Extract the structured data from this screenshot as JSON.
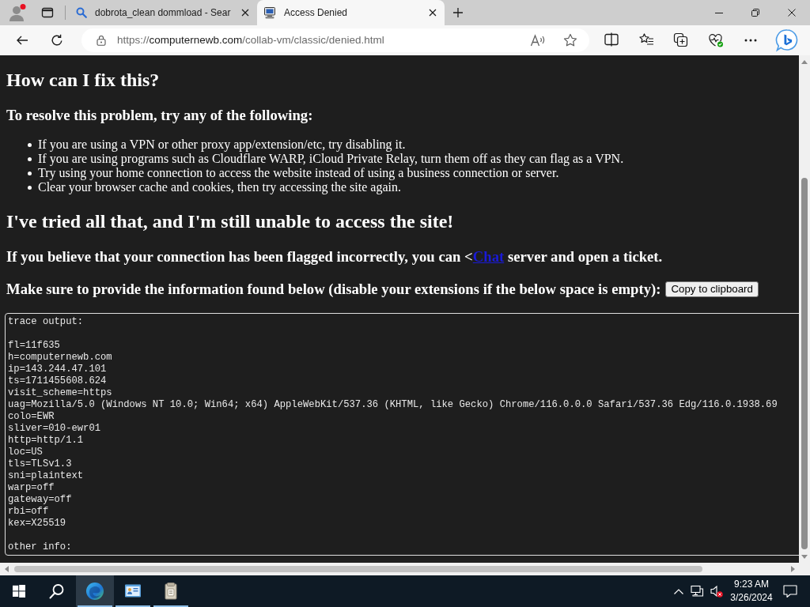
{
  "browser": {
    "tabs": [
      {
        "kind": "search",
        "title": "dobrota_clean dommload - Sear",
        "selected": false
      },
      {
        "kind": "page",
        "title": "Access Denied",
        "selected": true
      }
    ],
    "address_bar": {
      "url": {
        "scheme": "https://",
        "host": "computernewb.com",
        "path": "/collab-vm/classic/denied.html"
      }
    }
  },
  "page": {
    "fix_heading": "How can I fix this?",
    "resolve_heading": "To resolve this problem, try any of the following:",
    "tips": [
      "If you are using a VPN or other proxy app/extension/etc, try disabling it.",
      "If you are using programs such as Cloudflare WARP, iCloud Private Relay, turn them off as they can flag as a VPN.",
      "Try using your home connection to access the website instead of using a business connection or server.",
      "Clear your browser cache and cookies, then try accessing the site again."
    ],
    "tried_heading": "I've tried all that, and I'm still unable to access the site!",
    "contact_note": {
      "before": "If you believe that your connection has been flagged incorrectly, you can <",
      "link": "Chat",
      "after": " server and open a ticket."
    },
    "provide_note": "Make sure to provide the information found below (disable your extensions if the below space is empty):",
    "copy_button": "Copy to clipboard",
    "trace": {
      "header": "trace output:",
      "lines": [
        "fl=11f635",
        "h=computernewb.com",
        "ip=143.244.47.101",
        "ts=1711455608.624",
        "visit_scheme=https",
        "uag=Mozilla/5.0 (Windows NT 10.0; Win64; x64) AppleWebKit/537.36 (KHTML, like Gecko) Chrome/116.0.0.0 Safari/537.36 Edg/116.0.1938.69",
        "colo=EWR",
        "sliver=010-ewr01",
        "http=http/1.1",
        "loc=US",
        "tls=TLSv1.3",
        "sni=plaintext",
        "warp=off",
        "gateway=off",
        "rbi=off",
        "kex=X25519"
      ],
      "footer": "other info:"
    }
  },
  "taskbar": {
    "apps": [
      {
        "kind": "browser",
        "selected": true,
        "open": true
      },
      {
        "kind": "window",
        "selected": false,
        "open": true
      },
      {
        "kind": "notebook",
        "selected": false,
        "open": true
      }
    ],
    "tray": {
      "muted": true
    },
    "clock": {
      "time": "9:23 AM",
      "date": "3/26/2024"
    }
  }
}
